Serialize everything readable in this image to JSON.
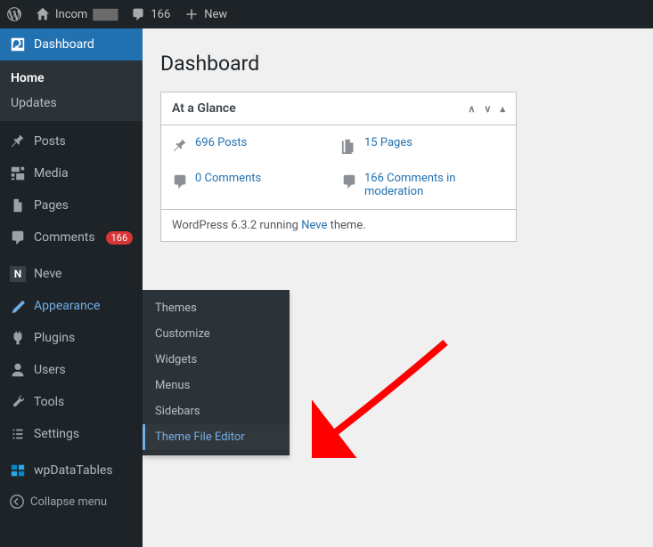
{
  "adminbar": {
    "site_name": "Incom",
    "comments_count": "166",
    "new_label": "New"
  },
  "sidebar": {
    "dashboard": "Dashboard",
    "home": "Home",
    "updates": "Updates",
    "posts": "Posts",
    "media": "Media",
    "pages": "Pages",
    "comments": "Comments",
    "comments_badge": "166",
    "neve": "Neve",
    "appearance": "Appearance",
    "plugins": "Plugins",
    "users": "Users",
    "tools": "Tools",
    "settings": "Settings",
    "wpdatatables": "wpDataTables",
    "collapse": "Collapse menu"
  },
  "appearance_submenu": {
    "themes": "Themes",
    "customize": "Customize",
    "widgets": "Widgets",
    "menus": "Menus",
    "sidebars": "Sidebars",
    "theme_file_editor": "Theme File Editor"
  },
  "page": {
    "title": "Dashboard",
    "glance": {
      "heading": "At a Glance",
      "posts": "696 Posts",
      "pages": "15 Pages",
      "comments": "0 Comments",
      "moderation": "166 Comments in moderation",
      "version_prefix": "WordPress 6.3.2 running ",
      "theme_link": "Neve",
      "version_suffix": " theme."
    }
  }
}
